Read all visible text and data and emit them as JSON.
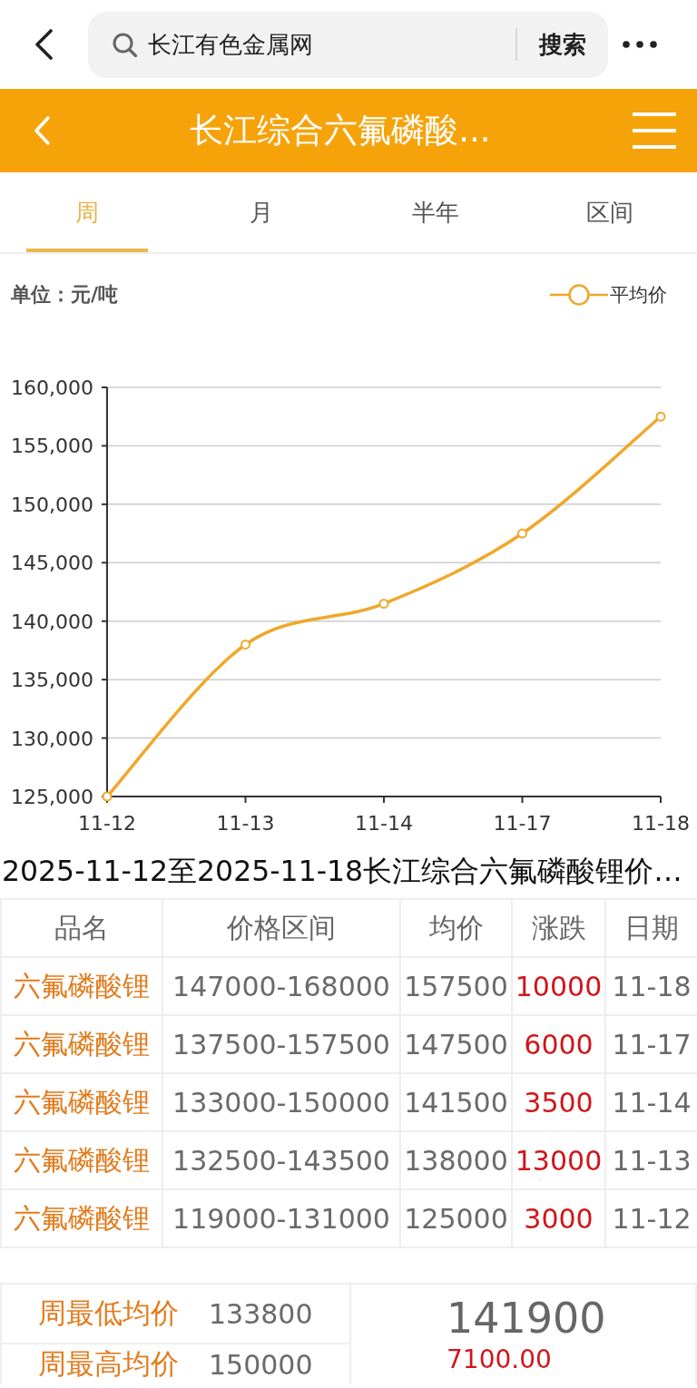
{
  "search_bar": {
    "value": "长江有色金属网",
    "button": "搜索"
  },
  "header": {
    "title": "长江综合六氟磷酸..."
  },
  "tabs": [
    {
      "label": "周",
      "selected": true
    },
    {
      "label": "月",
      "selected": false
    },
    {
      "label": "半年",
      "selected": false
    },
    {
      "label": "区间",
      "selected": false
    }
  ],
  "chart": {
    "chart_data": {
      "type": "line",
      "ylabel": "单位：元/吨",
      "categories": [
        "11-12",
        "11-13",
        "11-14",
        "11-17",
        "11-18"
      ],
      "series": [
        {
          "name": "平均价",
          "color": "#f0a72b",
          "marker": "circle",
          "values": [
            125000,
            138000,
            141500,
            147500,
            157500
          ]
        }
      ],
      "ylim": [
        125000,
        160000
      ],
      "yticks": [
        {
          "value": 125000,
          "label": "125,000"
        },
        {
          "value": 130000,
          "label": "130,000"
        },
        {
          "value": 135000,
          "label": "135,000"
        },
        {
          "value": 140000,
          "label": "140,000"
        },
        {
          "value": 145000,
          "label": "145,000"
        },
        {
          "value": 150000,
          "label": "150,000"
        },
        {
          "value": 155000,
          "label": "155,000"
        },
        {
          "value": 160000,
          "label": "160,000"
        }
      ],
      "grid": true
    }
  },
  "caption": "2025-11-12至2025-11-18长江综合六氟磷酸锂价…",
  "table": {
    "columns": [
      "品名",
      "价格区间",
      "均价",
      "涨跌",
      "日期"
    ],
    "rows": [
      {
        "cells": [
          "六氟磷酸锂",
          "147000-168000",
          "157500",
          "10000",
          "11-18"
        ],
        "rise": true
      },
      {
        "cells": [
          "六氟磷酸锂",
          "137500-157500",
          "147500",
          "6000",
          "11-17"
        ],
        "rise": true
      },
      {
        "cells": [
          "六氟磷酸锂",
          "133000-150000",
          "141500",
          "3500",
          "11-14"
        ],
        "rise": true
      },
      {
        "cells": [
          "六氟磷酸锂",
          "132500-143500",
          "138000",
          "13000",
          "11-13"
        ],
        "rise": true
      },
      {
        "cells": [
          "六氟磷酸锂",
          "119000-131000",
          "125000",
          "3000",
          "11-12"
        ],
        "rise": true
      }
    ]
  },
  "summary": {
    "stats": [
      {
        "label": "周最低均价",
        "value": "133800"
      },
      {
        "label": "周最高均价",
        "value": "150000"
      }
    ],
    "average": "141900",
    "change": "7100.00",
    "rise": true
  }
}
